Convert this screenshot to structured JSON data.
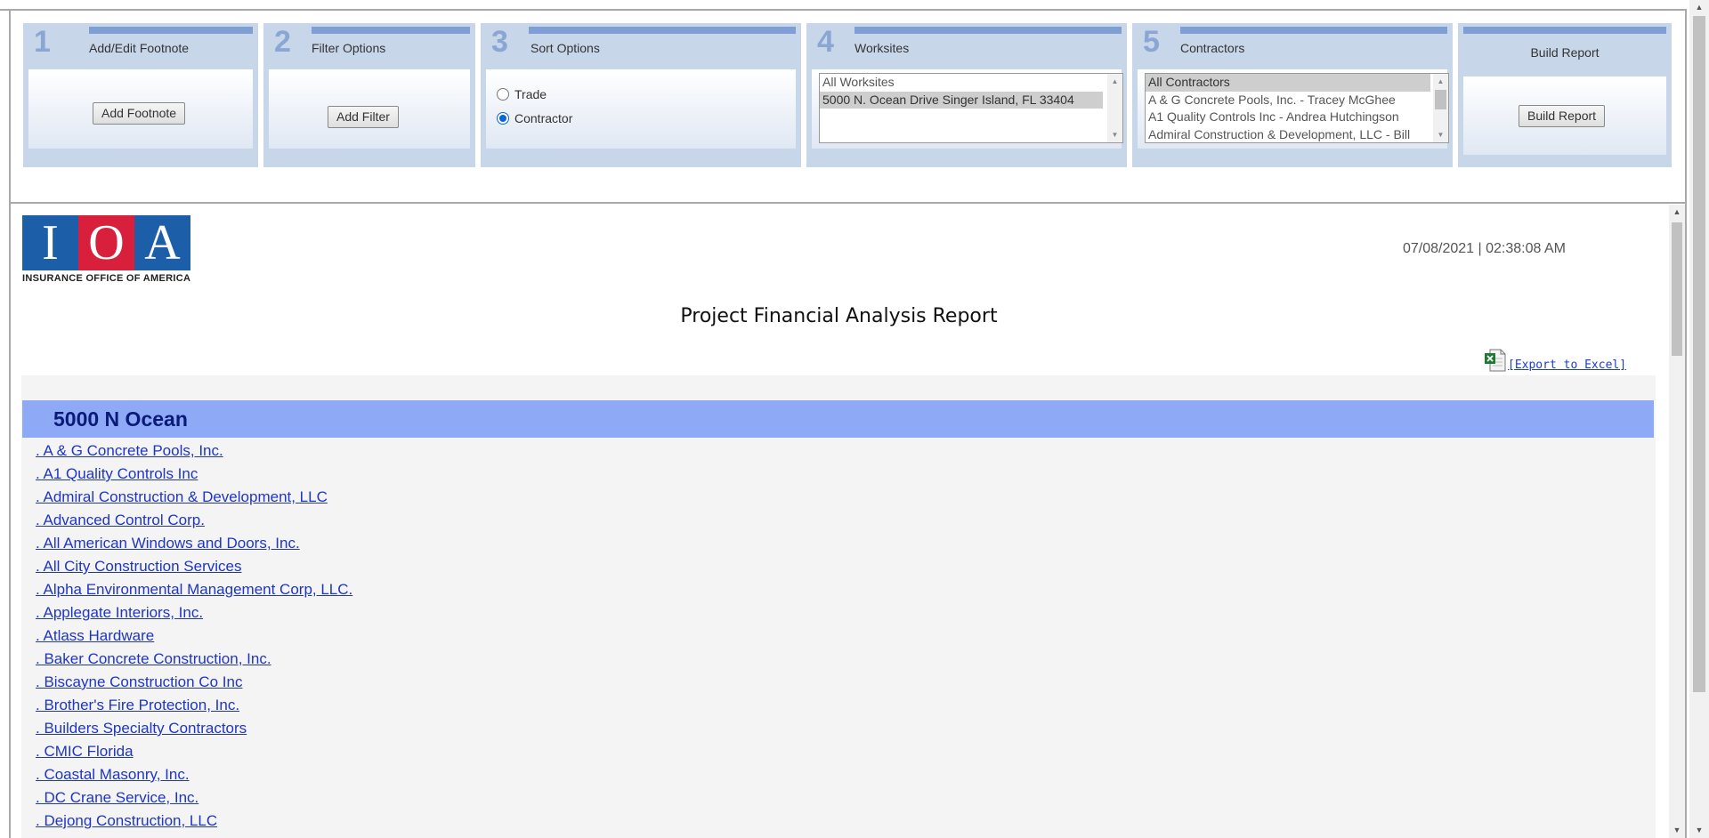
{
  "steps": [
    {
      "number": "1",
      "title": "Add/Edit Footnote",
      "button": "Add Footnote"
    },
    {
      "number": "2",
      "title": "Filter Options",
      "button": "Add Filter"
    },
    {
      "number": "3",
      "title": "Sort Options",
      "radios": [
        {
          "label": "Trade",
          "checked": false
        },
        {
          "label": "Contractor",
          "checked": true
        }
      ]
    },
    {
      "number": "4",
      "title": "Worksites",
      "options": [
        "All Worksites",
        "5000 N. Ocean Drive Singer Island, FL 33404"
      ],
      "selected": "5000 N. Ocean Drive Singer Island, FL 33404"
    },
    {
      "number": "5",
      "title": "Contractors",
      "options": [
        "All Contractors",
        "A & G Concrete Pools, Inc. - Tracey McGhee",
        "A1 Quality Controls Inc - Andrea Hutchingson",
        "Admiral Construction & Development, LLC - Bill"
      ],
      "selected": "All Contractors"
    },
    {
      "title": "Build Report",
      "button": "Build Report"
    }
  ],
  "logo": {
    "letters": [
      "I",
      "O",
      "A"
    ],
    "tagline": "INSURANCE OFFICE OF AMERICA",
    "colors": [
      "#1d5ea8",
      "#d81f3c",
      "#1d5ea8"
    ]
  },
  "report": {
    "timestamp": "07/08/2021 | 02:38:08 AM",
    "title": "Project Financial Analysis Report",
    "export_label": "[Export to Excel]",
    "group": "5000 N Ocean",
    "contractors": [
      ". A & G Concrete Pools, Inc.",
      ". A1 Quality Controls Inc",
      ". Admiral Construction & Development, LLC",
      ". Advanced Control Corp.",
      ". All American Windows and Doors, Inc.",
      ". All City Construction Services",
      ". Alpha Environmental Management Corp, LLC.",
      ". Applegate Interiors, Inc.",
      ". Atlass Hardware",
      ". Baker Concrete Construction, Inc.",
      ". Biscayne Construction Co Inc",
      ". Brother's Fire Protection, Inc.",
      ". Builders Specialty Contractors",
      ". CMIC Florida",
      ". Coastal Masonry, Inc.",
      ". DC Crane Service, Inc.",
      ". Dejong Construction, LLC"
    ]
  },
  "colors": {
    "panel_bg": "#c8d6ea",
    "accent_bar": "#7f9ed4",
    "group_header": "#8eaaf7",
    "link": "#1e35c7"
  }
}
